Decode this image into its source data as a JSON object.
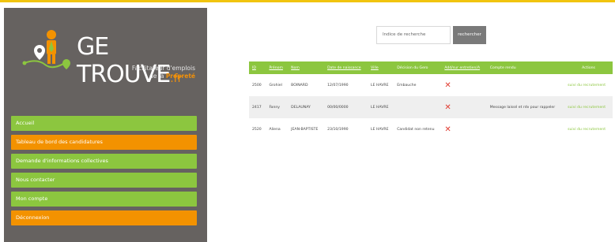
{
  "brand": {
    "name": "GE TROUVE",
    "suffix": ".fr",
    "tagline_line1": "Facilitateur d'emplois",
    "tagline_line2_prefix": "de la ",
    "tagline_line2_em": "Propreté"
  },
  "nav": {
    "items": [
      {
        "label": "Accueil",
        "color": "green"
      },
      {
        "label": "Tableau de bord des candidatures",
        "color": "orange"
      },
      {
        "label": "Demande d'informations collectives",
        "color": "green"
      },
      {
        "label": "Nous contacter",
        "color": "green"
      },
      {
        "label": "Mon compte",
        "color": "green"
      },
      {
        "label": "Déconnexion",
        "color": "orange"
      }
    ]
  },
  "search": {
    "placeholder": "Indice de recherche",
    "button_label": "rechercher"
  },
  "table": {
    "headers": [
      "ID",
      "Prénom",
      "Nom",
      "Date de naissance",
      "Ville",
      "Décision du Gero",
      "Add/sur entretien/A",
      "Compte rendu",
      "Actions"
    ],
    "rows": [
      {
        "id": "2500",
        "prenom": "Grohiel",
        "nom": "BOINARD",
        "date": "12/07/1990",
        "ville": "LE HAVRE",
        "decision": "Embauche",
        "compte_rendu": "",
        "action": "suivi du recrutement"
      },
      {
        "id": "2417",
        "prenom": "Fanny",
        "nom": "DELAUNAY",
        "date": "00/00/0000",
        "ville": "LE HAVRE",
        "decision": "",
        "compte_rendu": "Message laissé et rdv pour rappeler",
        "action": "suivi du recrutement"
      },
      {
        "id": "2520",
        "prenom": "Aliena",
        "nom": "JEAN-BAPTISTE",
        "date": "23/10/1990",
        "ville": "LE HAVRE",
        "decision": "Candidat non retenu",
        "compte_rendu": "",
        "action": "suivi du recrutement"
      }
    ]
  },
  "colors": {
    "green": "#8cc63f",
    "orange": "#f39200",
    "sidebar": "#666260",
    "cross": "#e03a2f"
  }
}
